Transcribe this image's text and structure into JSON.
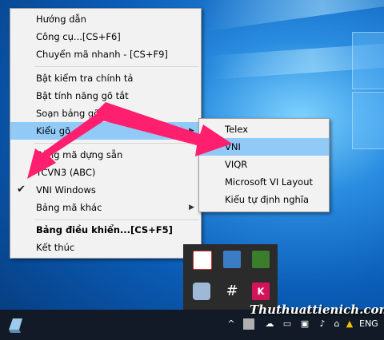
{
  "main_menu": {
    "items": [
      {
        "label": "Hướng dẫn"
      },
      {
        "label": "Công cụ...[CS+F6]"
      },
      {
        "label": "Chuyển mã nhanh - [CS+F9]"
      },
      {
        "label": "Bật kiểm tra chính tả"
      },
      {
        "label": "Bật tính năng gõ tắt"
      },
      {
        "label": "Soạn bảng gõ tắt..."
      },
      {
        "label": "Kiểu gõ"
      },
      {
        "label": "Bảng mã dựng sẵn"
      },
      {
        "label": "TCVN3 (ABC)"
      },
      {
        "label": "VNI Windows"
      },
      {
        "label": "Bảng mã khác"
      },
      {
        "label": "Bảng điều khiển...[CS+F5]"
      },
      {
        "label": "Kết thúc"
      }
    ]
  },
  "submenu": {
    "items": [
      {
        "label": "Telex"
      },
      {
        "label": "VNI"
      },
      {
        "label": "VIQR"
      },
      {
        "label": "Microsoft VI Layout"
      },
      {
        "label": "Kiểu tự định nghĩa"
      }
    ]
  },
  "taskbar": {
    "language": "ENG"
  },
  "watermark": "Thuthuattienich.com",
  "colors": {
    "highlight": "#91c9f7",
    "arrow": "#ff1f6e",
    "taskbar": "#111a26"
  }
}
